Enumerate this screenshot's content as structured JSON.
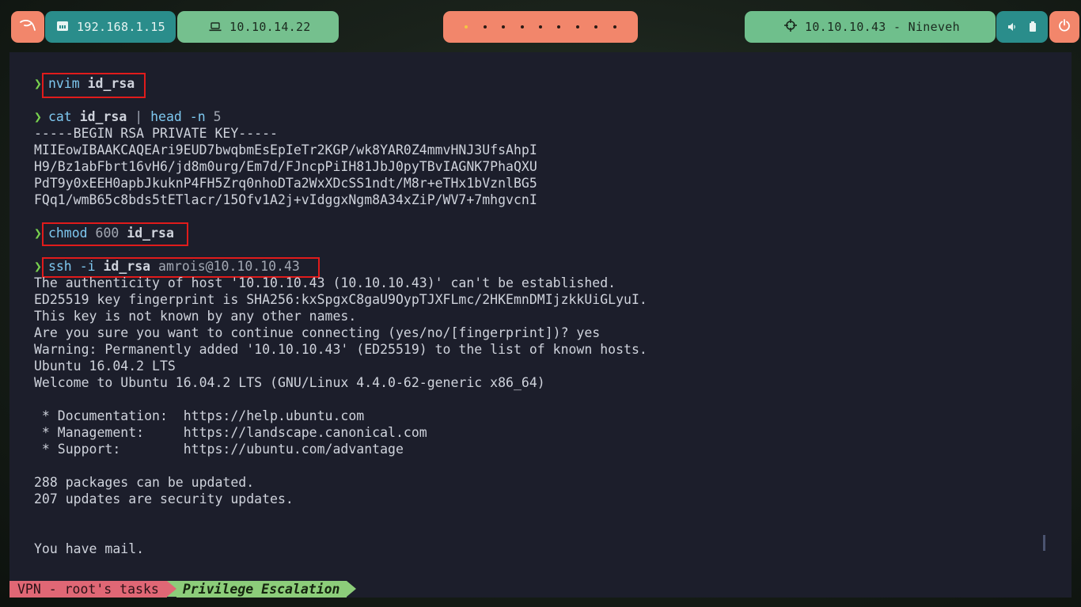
{
  "topbar": {
    "kali_icon": "kali-dragon-icon",
    "local_ip": "192.168.1.15",
    "vpn_ip": "10.10.14.22",
    "workspaces_count": 9,
    "target": "10.10.10.43 - Nineveh",
    "colors": {
      "accent": "#f2866b",
      "teal": "#2a8d8b",
      "green": "#75c08e"
    }
  },
  "terminal": {
    "cmd1": {
      "prompt": "❯",
      "command": "nvim",
      "arg": "id_rsa"
    },
    "cmd2": {
      "prompt": "❯",
      "command": "cat",
      "arg": "id_rsa",
      "pipe": "|",
      "command2": "head",
      "flag": "-n",
      "value": "5"
    },
    "key_lines": [
      "-----BEGIN RSA PRIVATE KEY-----",
      "MIIEowIBAAKCAQEAri9EUD7bwqbmEsEpIeTr2KGP/wk8YAR0Z4mmvHNJ3UfsAhpI",
      "H9/Bz1abFbrt16vH6/jd8m0urg/Em7d/FJncpPiIH81JbJ0pyTBvIAGNK7PhaQXU",
      "PdT9y0xEEH0apbJkuknP4FH5Zrq0nhoDTa2WxXDcSS1ndt/M8r+eTHx1bVznlBG5",
      "FQq1/wmB65c8bds5tETlacr/15Ofv1A2j+vIdggxNgm8A34xZiP/WV7+7mhgvcnI"
    ],
    "cmd3": {
      "prompt": "❯",
      "command": "chmod",
      "value": "600",
      "arg": "id_rsa"
    },
    "cmd4": {
      "prompt": "❯",
      "command": "ssh",
      "flag": "-i",
      "arg": "id_rsa",
      "dest": "amrois@10.10.10.43"
    },
    "ssh_output": [
      "The authenticity of host '10.10.10.43 (10.10.10.43)' can't be established.",
      "ED25519 key fingerprint is SHA256:kxSpgxC8gaU9OypTJXFLmc/2HKEmnDMIjzkkUiGLyuI.",
      "This key is not known by any other names.",
      "Are you sure you want to continue connecting (yes/no/[fingerprint])? yes",
      "Warning: Permanently added '10.10.10.43' (ED25519) to the list of known hosts.",
      "Ubuntu 16.04.2 LTS",
      "Welcome to Ubuntu 16.04.2 LTS (GNU/Linux 4.4.0-62-generic x86_64)"
    ],
    "motd": [
      " * Documentation:  https://help.ubuntu.com",
      " * Management:     https://landscape.canonical.com",
      " * Support:        https://ubuntu.com/advantage"
    ],
    "updates": [
      "288 packages can be updated.",
      "207 updates are security updates."
    ],
    "mail": "You have mail."
  },
  "statusline": {
    "session": "VPN - root's tasks",
    "window": "Privilege Escalation"
  }
}
